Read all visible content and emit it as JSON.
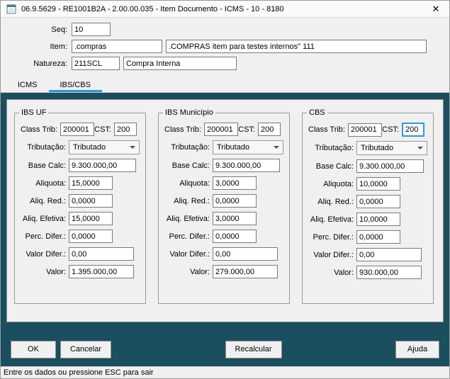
{
  "window": {
    "title": "06.9.5629 - RE1001B2A - 2.00.00.035 - Item Documento - ICMS - 10 - 8180",
    "close_glyph": "✕"
  },
  "header_fields": {
    "seq": {
      "label": "Seq:",
      "value": "10"
    },
    "item": {
      "label": "Item:",
      "code": ".compras",
      "desc": ".COMPRAS item para testes internos\" 111"
    },
    "natureza": {
      "label": "Natureza:",
      "code": "211SCL",
      "desc": "Compra Interna"
    }
  },
  "tabs": [
    {
      "label": "ICMS"
    },
    {
      "label": "IBS/CBS"
    }
  ],
  "labels": {
    "class_trib": "Class Trib:",
    "cst": "CST:",
    "tributacao": "Tributação:",
    "base_calc": "Base Calc:",
    "aliquota": "Aliquota:",
    "aliq_red": "Aliq. Red.:",
    "aliq_efetiva": "Aliq. Efetiva:",
    "perc_difer": "Perc. Difer.:",
    "valor_difer": "Valor Difer.:",
    "valor": "Valor:"
  },
  "groups": [
    {
      "title": "IBS UF",
      "class_trib": "200001",
      "cst": "200",
      "tributacao": "Tributado",
      "base_calc": "9.300.000,00",
      "aliquota": "15,0000",
      "aliq_red": "0,0000",
      "aliq_efetiva": "15,0000",
      "perc_difer": "0,0000",
      "valor_difer": "0,00",
      "valor": "1.395.000,00"
    },
    {
      "title": "IBS Município",
      "class_trib": "200001",
      "cst": "200",
      "tributacao": "Tributado",
      "base_calc": "9.300.000,00",
      "aliquota": "3,0000",
      "aliq_red": "0,0000",
      "aliq_efetiva": "3,0000",
      "perc_difer": "0,0000",
      "valor_difer": "0,00",
      "valor": "279.000,00"
    },
    {
      "title": "CBS",
      "class_trib": "200001",
      "cst": "200",
      "tributacao": "Tributado",
      "base_calc": "9.300.000,00",
      "aliquota": "10,0000",
      "aliq_red": "0,0000",
      "aliq_efetiva": "10,0000",
      "perc_difer": "0,0000",
      "valor_difer": "0,00",
      "valor": "930.000,00"
    }
  ],
  "buttons": {
    "ok": "OK",
    "cancelar": "Cancelar",
    "recalcular": "Recalcular",
    "ajuda": "Ajuda"
  },
  "status": "Entre os dados ou pressione ESC para sair",
  "colors": {
    "teal_background": "#1a4f5f",
    "tab_accent": "#2b9ad8",
    "focus_border": "#2b9ad8"
  }
}
